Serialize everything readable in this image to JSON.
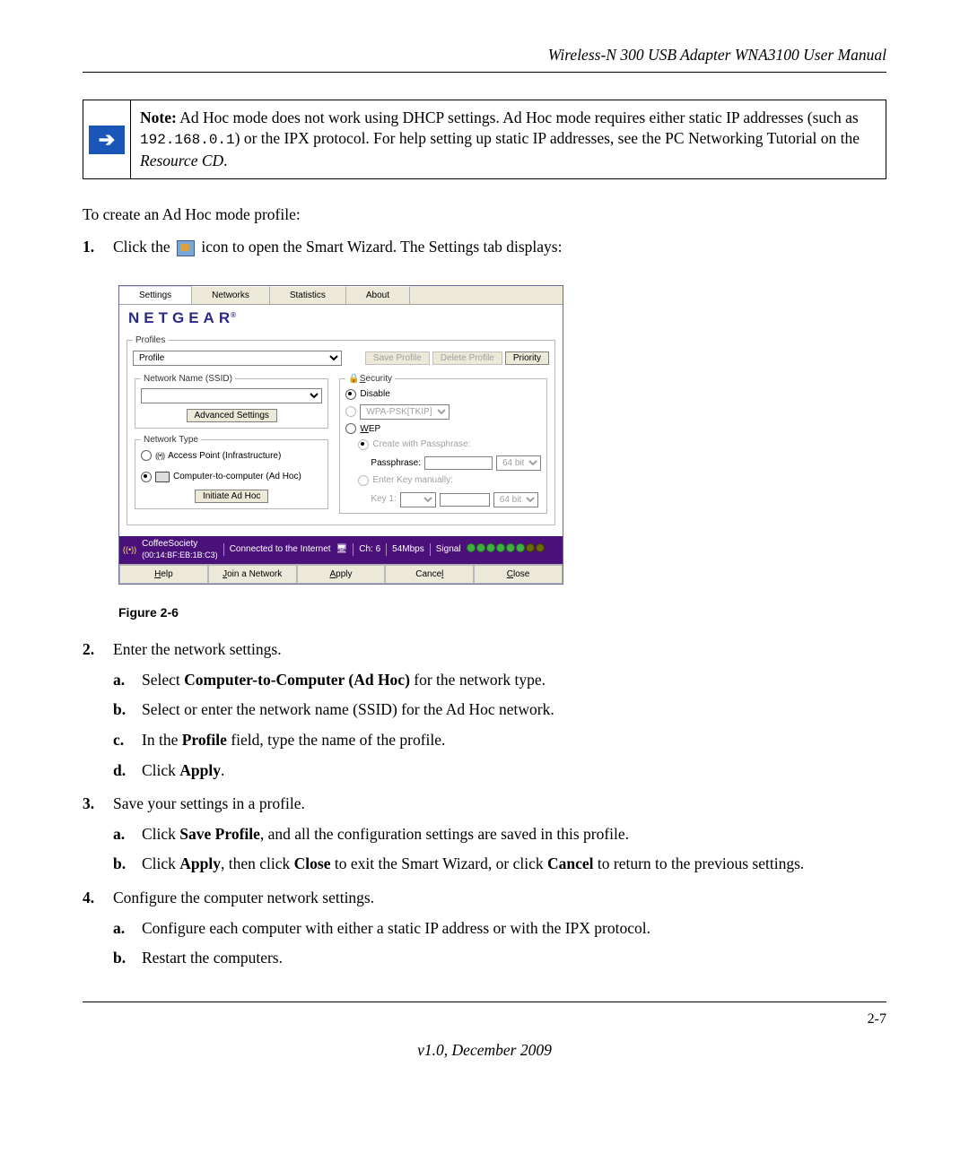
{
  "header_title": "Wireless-N 300 USB Adapter WNA3100 User Manual",
  "note": {
    "label": "Note:",
    "text1": " Ad Hoc mode does not work using DHCP settings. Ad Hoc mode requires either static IP addresses (such as ",
    "ip": "192.168.0.1",
    "text2": ") or the IPX protocol. For help setting up static IP addresses, see the PC Networking Tutorial on the ",
    "resource": "Resource CD",
    "text3": "."
  },
  "intro": "To create an Ad Hoc mode profile:",
  "step1": {
    "num": "1.",
    "pre": "Click the ",
    "post": " icon to open the Smart Wizard. The Settings tab displays:"
  },
  "wizard": {
    "tabs": [
      "Settings",
      "Networks",
      "Statistics",
      "About"
    ],
    "brand": "NETGEAR",
    "profiles_legend": "Profiles",
    "profile_value": "Profile",
    "btn_save_profile": "Save Profile",
    "btn_delete_profile": "Delete Profile",
    "btn_priority": "Priority",
    "ssid_legend": "Network Name (SSID)",
    "advanced": "Advanced Settings",
    "nettype_legend": "Network Type",
    "opt_ap": "Access Point (Infrastructure)",
    "opt_adhoc": "Computer-to-computer (Ad Hoc)",
    "btn_initiate": "Initiate Ad Hoc",
    "sec_legend": "Security",
    "sec_disable": "Disable",
    "sec_wpa": "WPA-PSK[TKIP]",
    "sec_wep": "WEP",
    "wep_create": "Create with Passphrase:",
    "wep_pass": "Passphrase:",
    "wep_bits1": "64 bits",
    "wep_manual": "Enter Key manually:",
    "wep_key": "Key 1:",
    "wep_bits2": "64 bits",
    "status": {
      "ssid": "CoffeeSociety",
      "mac": "(00:14:BF:EB:1B:C3)",
      "conn": "Connected to the Internet",
      "ch_label": "Ch:",
      "ch": "6",
      "rate": "54Mbps",
      "signal": "Signal"
    },
    "bottom": {
      "help": "Help",
      "join": "Join a Network",
      "apply": "Apply",
      "cancel": "Cancel",
      "close": "Close"
    }
  },
  "fig_caption": "Figure 2-6",
  "step2": {
    "num": "2.",
    "text": "Enter the network settings.",
    "a": {
      "num": "a.",
      "pre": "Select ",
      "bold": "Computer-to-Computer (Ad Hoc)",
      "post": " for the network type."
    },
    "b": {
      "num": "b.",
      "text": "Select or enter the network name (SSID) for the Ad Hoc network."
    },
    "c": {
      "num": "c.",
      "pre": "In the ",
      "bold": "Profile",
      "post": " field, type the name of the profile."
    },
    "d": {
      "num": "d.",
      "pre": "Click ",
      "bold": "Apply",
      "post": "."
    }
  },
  "step3": {
    "num": "3.",
    "text": "Save your settings in a profile.",
    "a": {
      "num": "a.",
      "pre": "Click ",
      "bold": "Save Profile",
      "post": ", and all the configuration settings are saved in this profile."
    },
    "b": {
      "num": "b.",
      "pre": "Click ",
      "bold1": "Apply",
      "mid": ", then click ",
      "bold2": "Close",
      "mid2": " to exit the Smart Wizard, or click ",
      "bold3": "Cancel",
      "post": " to return to the previous settings."
    }
  },
  "step4": {
    "num": "4.",
    "text": "Configure the computer network settings.",
    "a": {
      "num": "a.",
      "text": "Configure each computer with either a static IP address or with the IPX protocol."
    },
    "b": {
      "num": "b.",
      "text": "Restart the computers."
    }
  },
  "page_no": "2-7",
  "footer_ver": "v1.0, December 2009"
}
